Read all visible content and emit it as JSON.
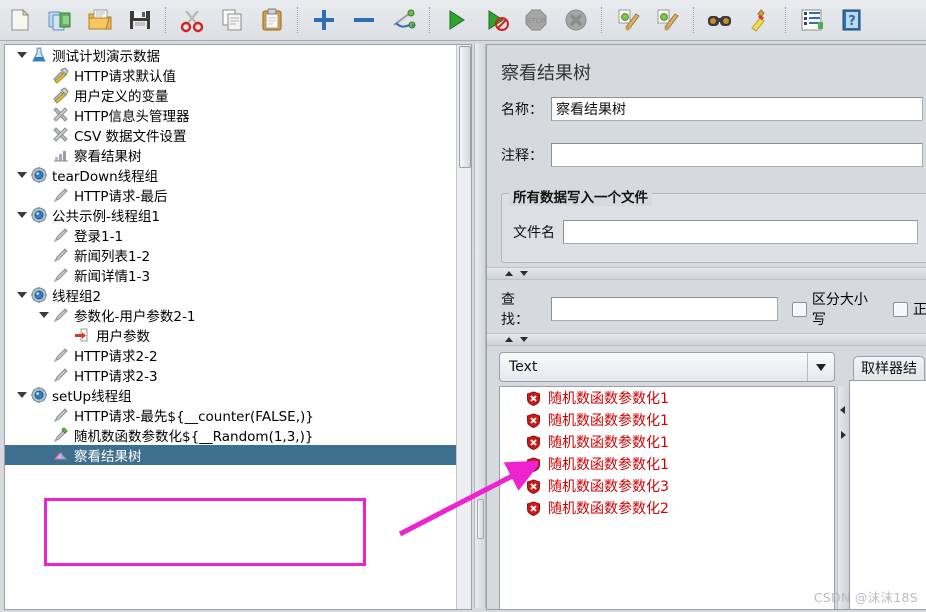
{
  "toolbar": {
    "buttons": [
      {
        "name": "new-icon",
        "title": "New"
      },
      {
        "name": "templates-icon",
        "title": "Templates"
      },
      {
        "name": "open-icon",
        "title": "Open"
      },
      {
        "name": "save-icon",
        "title": "Save"
      },
      {
        "sep": true
      },
      {
        "name": "cut-icon",
        "title": "Cut"
      },
      {
        "name": "copy-icon",
        "title": "Copy"
      },
      {
        "name": "paste-icon",
        "title": "Paste"
      },
      {
        "sep": true
      },
      {
        "name": "expand-all-icon",
        "title": "Expand All"
      },
      {
        "name": "collapse-all-icon",
        "title": "Collapse All"
      },
      {
        "name": "toggle-icon",
        "title": "Toggle"
      },
      {
        "sep": true
      },
      {
        "name": "start-icon",
        "title": "Start"
      },
      {
        "name": "start-no-pause-icon",
        "title": "Start no timers"
      },
      {
        "name": "stop-icon",
        "title": "Stop"
      },
      {
        "name": "shutdown-icon",
        "title": "Shutdown"
      },
      {
        "sep": true
      },
      {
        "name": "clear-icon",
        "title": "Clear"
      },
      {
        "name": "clear-all-icon",
        "title": "Clear All"
      },
      {
        "sep": true
      },
      {
        "name": "search-icon",
        "title": "Search"
      },
      {
        "name": "reset-search-icon",
        "title": "Reset Search"
      },
      {
        "sep": true
      },
      {
        "name": "function-helper-icon",
        "title": "Function Helper Dialog"
      },
      {
        "name": "help-icon",
        "title": "Help"
      }
    ]
  },
  "tree": {
    "nodes": [
      {
        "label": "测试计划演示数据",
        "depth": 0,
        "icon": "test-plan-icon",
        "toggle": "expanded"
      },
      {
        "label": "HTTP请求默认值",
        "depth": 1,
        "icon": "config-wrench-yellow-icon",
        "toggle": "none"
      },
      {
        "label": "用户定义的变量",
        "depth": 1,
        "icon": "config-wrench-yellow-icon",
        "toggle": "none"
      },
      {
        "label": "HTTP信息头管理器",
        "depth": 1,
        "icon": "config-wrench-icon",
        "toggle": "none"
      },
      {
        "label": "CSV 数据文件设置",
        "depth": 1,
        "icon": "config-wrench-icon",
        "toggle": "none"
      },
      {
        "label": "察看结果树",
        "depth": 1,
        "icon": "view-results-tree-icon",
        "toggle": "none"
      },
      {
        "label": "tearDown线程组",
        "depth": 0,
        "icon": "thread-group-icon",
        "toggle": "expanded"
      },
      {
        "label": "HTTP请求-最后",
        "depth": 1,
        "icon": "http-sampler-icon",
        "toggle": "none"
      },
      {
        "label": "公共示例-线程组1",
        "depth": 0,
        "icon": "thread-group-icon",
        "toggle": "expanded"
      },
      {
        "label": "登录1-1",
        "depth": 1,
        "icon": "http-sampler-icon",
        "toggle": "none"
      },
      {
        "label": "新闻列表1-2",
        "depth": 1,
        "icon": "http-sampler-icon",
        "toggle": "none"
      },
      {
        "label": "新闻详情1-3",
        "depth": 1,
        "icon": "http-sampler-icon",
        "toggle": "none"
      },
      {
        "label": "线程组2",
        "depth": 0,
        "icon": "thread-group-icon",
        "toggle": "expanded"
      },
      {
        "label": "参数化-用户参数2-1",
        "depth": 1,
        "icon": "http-sampler-icon",
        "toggle": "expanded"
      },
      {
        "label": "用户参数",
        "depth": 2,
        "icon": "user-parameters-icon",
        "toggle": "none"
      },
      {
        "label": "HTTP请求2-2",
        "depth": 1,
        "icon": "http-sampler-icon",
        "toggle": "none"
      },
      {
        "label": "HTTP请求2-3",
        "depth": 1,
        "icon": "http-sampler-icon",
        "toggle": "none"
      },
      {
        "label": "setUp线程组",
        "depth": 0,
        "icon": "thread-group-icon",
        "toggle": "expanded"
      },
      {
        "label": "HTTP请求-最先${__counter(FALSE,)}",
        "depth": 1,
        "icon": "http-sampler-icon",
        "toggle": "none"
      },
      {
        "label": "随机数函数参数化${__Random(1,3,)}",
        "depth": 1,
        "icon": "http-sampler-green-icon",
        "toggle": "none"
      },
      {
        "label": "察看结果树",
        "depth": 1,
        "icon": "view-results-tree-icon",
        "toggle": "none",
        "selected": true
      }
    ]
  },
  "right": {
    "title": "察看结果树",
    "name_label": "名称：",
    "name_value": "察看结果树",
    "comment_label": "注释：",
    "comment_value": "",
    "file_group_title": "所有数据写入一个文件",
    "filename_label": "文件名",
    "filename_value": "",
    "search_label": "查找：",
    "search_value": "",
    "search_placeholder": "",
    "checkbox_case_label": "区分大小写",
    "checkbox_regex_label": "正",
    "renderer_selected": "Text",
    "results": [
      "随机数函数参数化1",
      "随机数函数参数化1",
      "随机数函数参数化1",
      "随机数函数参数化1",
      "随机数函数参数化3",
      "随机数函数参数化2"
    ],
    "detail_tab": "取样器结"
  },
  "annotations": {
    "highlight_color": "#ef22cf",
    "watermark": "CSDN @沫沫18S"
  }
}
